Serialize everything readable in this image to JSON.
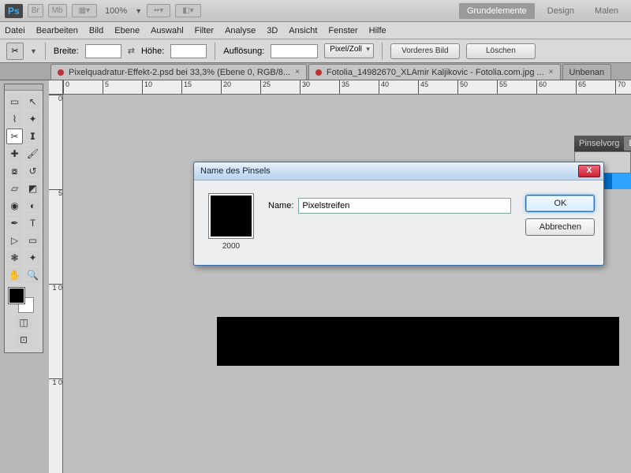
{
  "topbar": {
    "ps": "Ps",
    "chips": [
      "Br",
      "Mb"
    ],
    "zoom": "100%",
    "tabs": [
      "Grundelemente",
      "Design",
      "Malen"
    ],
    "active_tab": 0
  },
  "menu": [
    "Datei",
    "Bearbeiten",
    "Bild",
    "Ebene",
    "Auswahl",
    "Filter",
    "Analyse",
    "3D",
    "Ansicht",
    "Fenster",
    "Hilfe"
  ],
  "options": {
    "width_label": "Breite:",
    "height_label": "Höhe:",
    "res_label": "Auflösung:",
    "unit": "Pixel/Zoll",
    "btn_front": "Vorderes Bild",
    "btn_clear": "Löschen"
  },
  "doc_tabs": [
    {
      "title": "Pixelquadratur-Effekt-2.psd bei 33,3% (Ebene 0, RGB/8...",
      "dirty": true
    },
    {
      "title": "Fotolia_14982670_XLAmir Kaljikovic - Fotolia.com.jpg ...",
      "dirty": true
    },
    {
      "title": "Unbenan",
      "dirty": false
    }
  ],
  "ruler_h": [
    "0",
    "5",
    "10",
    "15",
    "20",
    "25",
    "30",
    "35",
    "40",
    "45",
    "50",
    "55",
    "60",
    "65",
    "70"
  ],
  "ruler_v": [
    "0",
    "5",
    "1 0",
    "1 0"
  ],
  "side_panel": {
    "tabs": [
      "Pinselvorg",
      "Eb"
    ],
    "active": 1
  },
  "dialog": {
    "title": "Name des Pinsels",
    "name_label": "Name:",
    "name_value": "Pixelstreifen",
    "preview_caption": "2000",
    "ok": "OK",
    "cancel": "Abbrechen"
  }
}
